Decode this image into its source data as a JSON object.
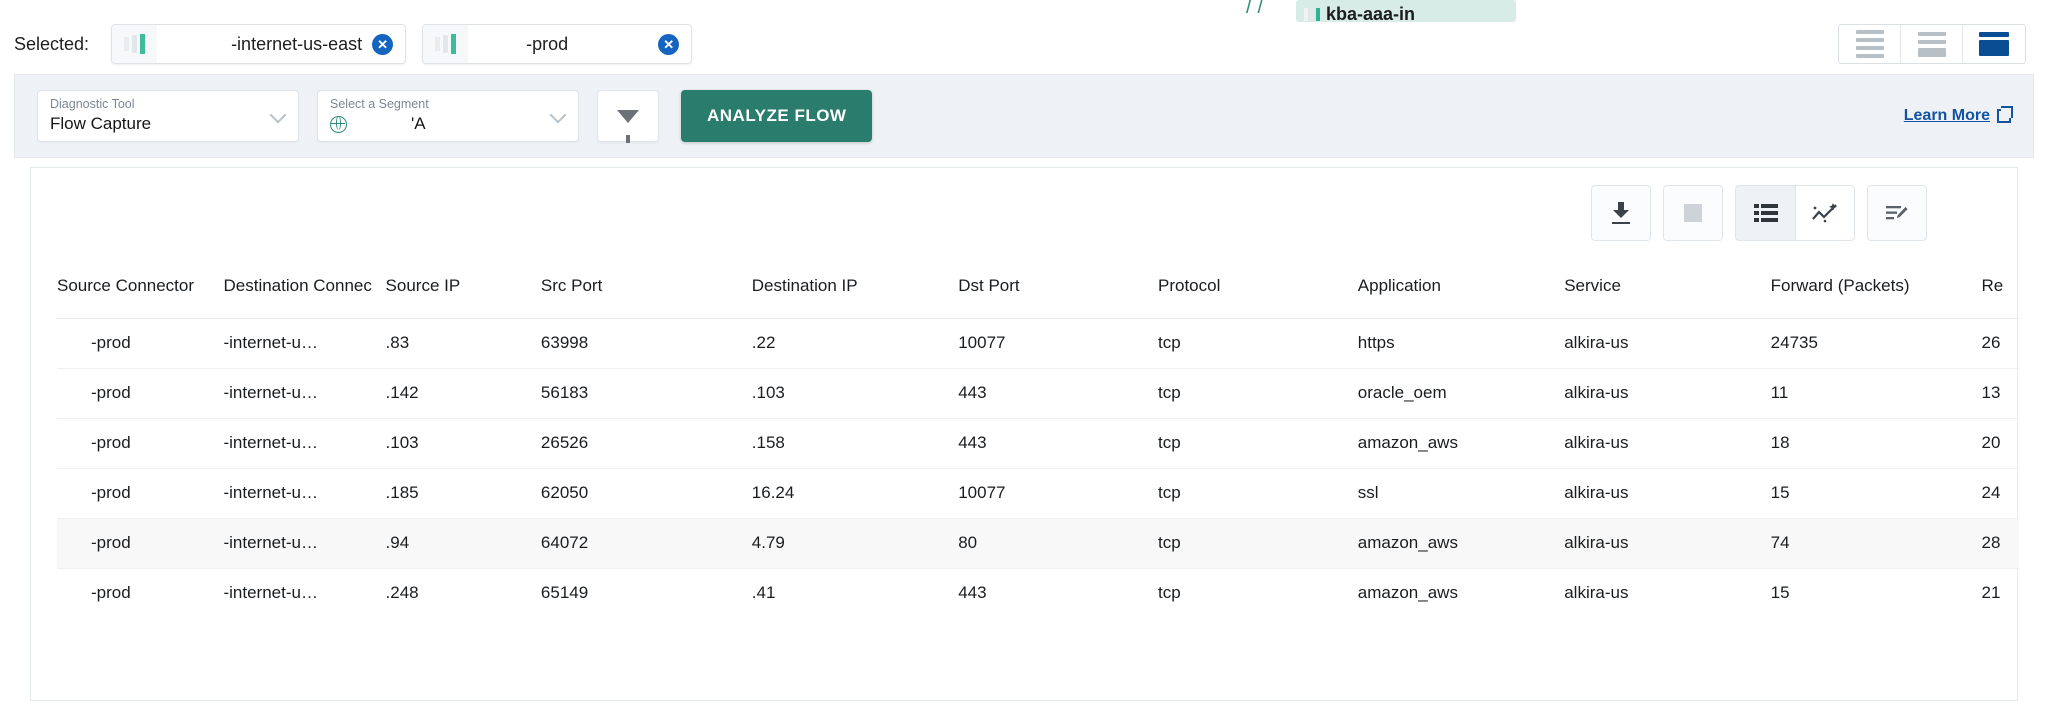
{
  "top_sliver": {
    "text": "kba-aaa-in",
    "slashes": "//"
  },
  "selected_bar": {
    "label": "Selected:",
    "chips": [
      {
        "text": "-internet-us-east",
        "close_icon": "close-circle-icon",
        "has_tail": false
      },
      {
        "text": "-prod",
        "close_icon": "close-circle-icon",
        "has_tail": true
      }
    ],
    "layout_toggles": [
      {
        "name": "layout-list-icon",
        "active": false
      },
      {
        "name": "layout-split-icon",
        "active": false
      },
      {
        "name": "layout-full-icon",
        "active": true
      }
    ]
  },
  "controls": {
    "diagnostic_tool": {
      "label": "Diagnostic Tool",
      "value": "Flow Capture"
    },
    "segment": {
      "label": "Select a Segment",
      "value": "'A",
      "icon": "globe-icon"
    },
    "filter_button": {
      "icon": "funnel-icon"
    },
    "analyze_button": "ANALYZE FLOW",
    "learn_more": "Learn More",
    "accent_color": "#2a7d6d",
    "link_color": "#14539e"
  },
  "panel": {
    "toolbar": [
      {
        "name": "download-icon",
        "label": "Download",
        "state": "enabled"
      },
      {
        "name": "stop-icon",
        "label": "Stop",
        "state": "disabled"
      },
      {
        "name": "table-view-icon",
        "label": "Table View",
        "state": "active"
      },
      {
        "name": "chart-view-icon",
        "label": "Chart View",
        "state": "enabled"
      },
      {
        "name": "edit-notes-icon",
        "label": "Edit",
        "state": "enabled"
      }
    ],
    "table": {
      "columns": [
        "Source Connector",
        "Destination Connec",
        "Source IP",
        "Src Port",
        "Destination IP",
        "Dst Port",
        "Protocol",
        "Application",
        "Service",
        "Forward (Packets)",
        "Re"
      ],
      "rows": [
        {
          "source_connector": "-prod",
          "destination_connector": "-internet-u…",
          "source_ip": ".83",
          "src_port": "63998",
          "destination_ip": ".22",
          "dst_port": "10077",
          "protocol": "tcp",
          "application": "https",
          "service": "alkira-us",
          "forward_packets": "24735",
          "reverse": "26",
          "highlighted": false
        },
        {
          "source_connector": "-prod",
          "destination_connector": "-internet-u…",
          "source_ip": ".142",
          "src_port": "56183",
          "destination_ip": ".103",
          "dst_port": "443",
          "protocol": "tcp",
          "application": "oracle_oem",
          "service": "alkira-us",
          "forward_packets": "11",
          "reverse": "13",
          "highlighted": false
        },
        {
          "source_connector": "-prod",
          "destination_connector": "-internet-u…",
          "source_ip": ".103",
          "src_port": "26526",
          "destination_ip": ".158",
          "dst_port": "443",
          "protocol": "tcp",
          "application": "amazon_aws",
          "service": "alkira-us",
          "forward_packets": "18",
          "reverse": "20",
          "highlighted": false
        },
        {
          "source_connector": "-prod",
          "destination_connector": "-internet-u…",
          "source_ip": ".185",
          "src_port": "62050",
          "destination_ip": "16.24",
          "dst_port": "10077",
          "protocol": "tcp",
          "application": "ssl",
          "service": "alkira-us",
          "forward_packets": "15",
          "reverse": "24",
          "highlighted": false
        },
        {
          "source_connector": "-prod",
          "destination_connector": "-internet-u…",
          "source_ip": ".94",
          "src_port": "64072",
          "destination_ip": "4.79",
          "dst_port": "80",
          "protocol": "tcp",
          "application": "amazon_aws",
          "service": "alkira-us",
          "forward_packets": "74",
          "reverse": "28",
          "highlighted": true
        },
        {
          "source_connector": "-prod",
          "destination_connector": "-internet-u…",
          "source_ip": ".248",
          "src_port": "65149",
          "destination_ip": ".41",
          "dst_port": "443",
          "protocol": "tcp",
          "application": "amazon_aws",
          "service": "alkira-us",
          "forward_packets": "15",
          "reverse": "21",
          "highlighted": false
        }
      ]
    }
  }
}
